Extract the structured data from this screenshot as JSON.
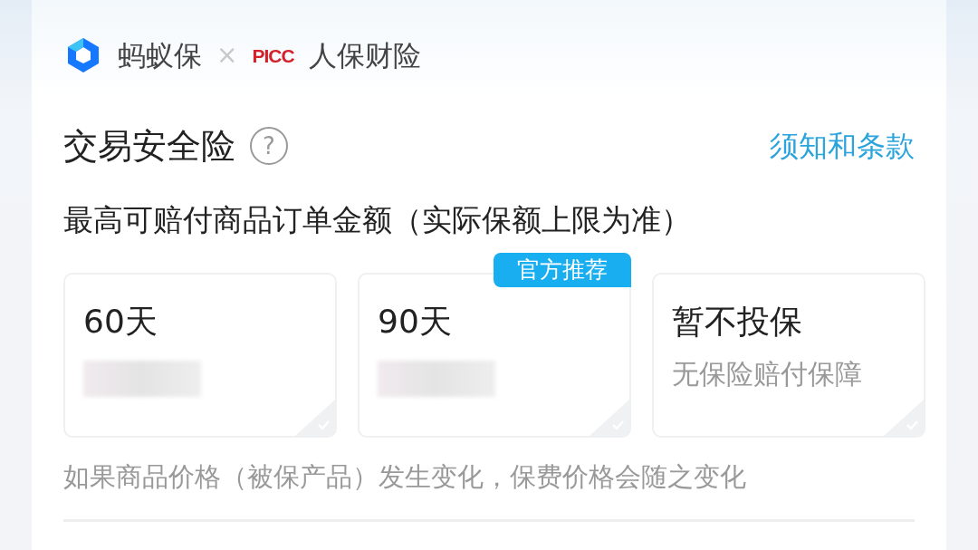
{
  "header": {
    "brand": "蚂蚁保",
    "separator": "×",
    "partner_logo": "PICC",
    "partner": "人保财险"
  },
  "title": "交易安全险",
  "help_icon": "?",
  "terms_link": "须知和条款",
  "subtitle": "最高可赔付商品订单金额（实际保额上限为准）",
  "options": [
    {
      "label": "60天",
      "kind": "priced",
      "selected": false
    },
    {
      "label": "90天",
      "kind": "priced",
      "badge": "官方推荐",
      "selected": false
    },
    {
      "label": "暂不投保",
      "kind": "none",
      "description": "无保险赔付保障",
      "selected": false
    }
  ],
  "note": "如果商品价格（被保产品）发生变化，保费价格会随之变化"
}
